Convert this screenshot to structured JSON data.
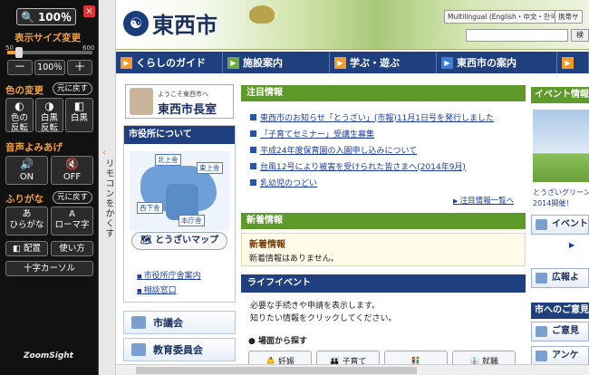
{
  "remote": {
    "zoom_label": "100％",
    "display_size_label": "表示サイズ変更",
    "zoom_min": "50",
    "zoom_max": "600",
    "zoom_minus": "－",
    "zoom_value": "100％",
    "zoom_plus": "＋",
    "zoom_level_fraction": 0.14,
    "color_change_label": "色の変更",
    "color_reset": "元に戻す",
    "color_btn1_line1": "色の",
    "color_btn1_line2": "反転",
    "color_btn2_line1": "白黒",
    "color_btn2_line2": "反転",
    "color_btn3": "白黒",
    "voice_label": "音声よみあげ",
    "voice_on": "ON",
    "voice_off": "OFF",
    "furigana_label": "ふりがな",
    "furigana_reset": "元に戻す",
    "hiragana_top": "あ",
    "hiragana": "ひらがな",
    "romaji_top": "A",
    "romaji": "ローマ字",
    "layout": "配置",
    "usage": "使い方",
    "crosshair": "十字カーソル",
    "brand": "ZoomSight",
    "tab_label": "リモコンをかくす"
  },
  "site": {
    "city_name": "東西市",
    "multilingual": "Multilingual (English・中文・한국어)",
    "mobile": "携帯サ",
    "search_btn": "検",
    "nav": [
      "くらしのガイド",
      "施設案内",
      "学ぶ・遊ぶ",
      "東西市の案内",
      ""
    ],
    "mayor_welcome": "ようこそ東西市へ",
    "mayor_title": "東西市長室",
    "cityhall_title": "市役所について",
    "map_labels": [
      "北上舎",
      "東上舎",
      "西下舎",
      "本庁舎"
    ],
    "map_button": "とうざいマップ",
    "cityhall_links": [
      "市役所庁舎案内",
      "相談窓口"
    ],
    "side_buttons": [
      "市議会",
      "教育委員会"
    ],
    "notice_title": "注目情報",
    "notices": [
      "東西市のお知らせ「とうざい」(市報)11月1日号を発行しました",
      "「子育てセミナー」受講生募集",
      "平成24年度保育園の入園申し込みについて",
      "台風12号により被害を受けられた皆さまへ(2014年9月)",
      "乳幼児のつどい"
    ],
    "notice_more": "注目情報一覧へ",
    "new_title": "新着情報",
    "new_box_head": "新着情報",
    "new_box_body": "新着情報はありません。",
    "life_title": "ライフイベント",
    "life_text1": "必要な手続きや申請を表示します。",
    "life_text2": "知りたい情報をクリックしてください。",
    "life_scene": "● 場面から探す",
    "life_buttons": [
      "妊娠",
      "子育て",
      "",
      "就職"
    ],
    "right_event_title": "イベント情報",
    "right_event_caption1": "とうざいグリーン",
    "right_event_caption2": "2014開催！",
    "right_event_btn": "イベント",
    "right_ad_btn": "広報よ",
    "right_opinion_title": "市へのご意見",
    "right_opinion_btn": "ご意見",
    "right_survey_btn": "アンケ"
  }
}
